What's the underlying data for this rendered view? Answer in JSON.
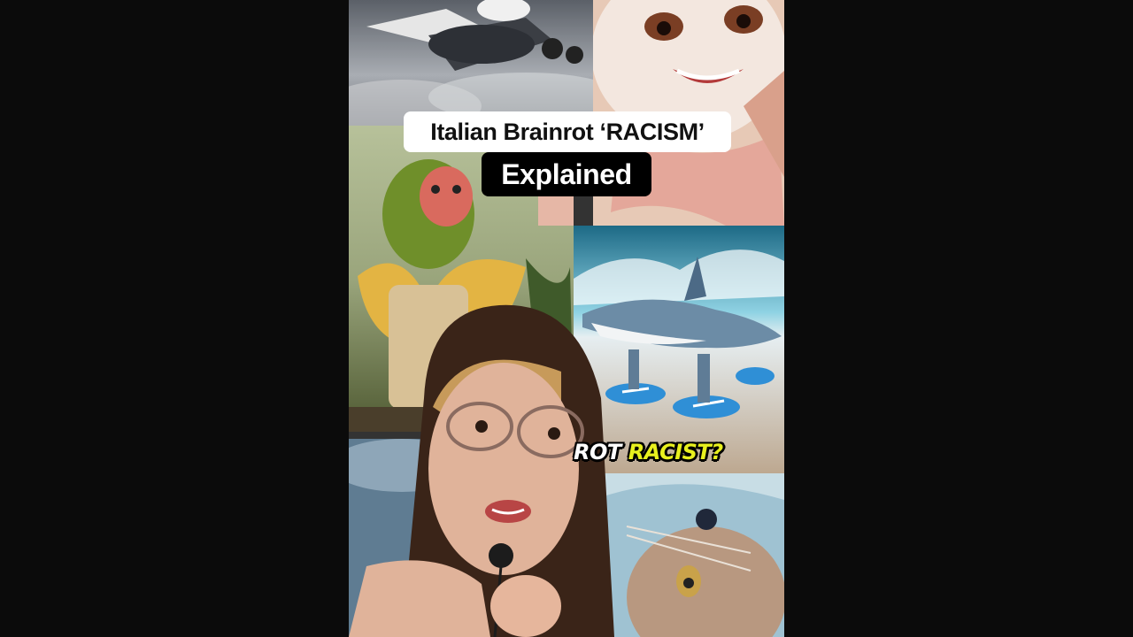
{
  "colors": {
    "page_background": "#0b0b0b",
    "title_box": "#ffffff",
    "subtitle_box": "#000000",
    "caption_white": "#ffffff",
    "caption_highlight": "#e8f01e"
  },
  "overlay": {
    "title_line1": "Italian Brainrot ‘RACISM’",
    "title_line2": "Explained"
  },
  "caption": {
    "word1": "ROT",
    "word2": "RACIST?"
  },
  "collage": {
    "tiles": [
      "flying-bomber-plane-image",
      "smiling-cartoon-face-image",
      "monkey-in-banana-image",
      "shark-in-sneakers-image",
      "cat-creature-image",
      "presenter-woman-image"
    ]
  }
}
